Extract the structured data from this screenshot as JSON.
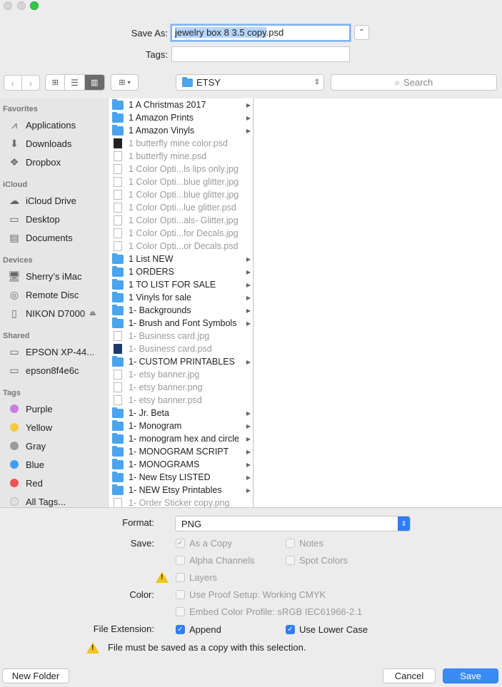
{
  "save_as": {
    "label": "Save As:",
    "value": "jewelry box 8 3.5 copy.psd",
    "selected": "jewelry box 8 3.5 copy",
    "rest": ".psd"
  },
  "tags": {
    "label": "Tags:",
    "value": ""
  },
  "location": {
    "folder": "ETSY"
  },
  "search": {
    "placeholder": "Search"
  },
  "sidebar": {
    "favorites_header": "Favorites",
    "favorites": [
      "Applications",
      "Downloads",
      "Dropbox"
    ],
    "icloud_header": "iCloud",
    "icloud": [
      "iCloud Drive",
      "Desktop",
      "Documents"
    ],
    "devices_header": "Devices",
    "devices": [
      "Sherry’s iMac",
      "Remote Disc",
      "NIKON D7000"
    ],
    "shared_header": "Shared",
    "shared": [
      "EPSON XP-44...",
      "epson8f4e6c"
    ],
    "tags_header": "Tags",
    "tags": [
      {
        "name": "Purple",
        "color": "#c77ede"
      },
      {
        "name": "Yellow",
        "color": "#f6c83e"
      },
      {
        "name": "Gray",
        "color": "#9b9b9b"
      },
      {
        "name": "Blue",
        "color": "#3d9df5"
      },
      {
        "name": "Red",
        "color": "#f2544f"
      },
      {
        "name": "All Tags...",
        "color": "#e0e0e0"
      }
    ]
  },
  "files": [
    {
      "name": "1 A  Christmas 2017",
      "kind": "folder"
    },
    {
      "name": "1 Amazon Prints",
      "kind": "folder"
    },
    {
      "name": "1 Amazon Vinyls",
      "kind": "folder"
    },
    {
      "name": "1 butterfly mine color.psd",
      "kind": "dark"
    },
    {
      "name": "1 butterfly mine.psd",
      "kind": "file"
    },
    {
      "name": "1 Color Opti...ls lips only.jpg",
      "kind": "file"
    },
    {
      "name": "1 Color Opti...blue glitter.jpg",
      "kind": "file"
    },
    {
      "name": "1 Color Opti...blue glitter.jpg",
      "kind": "file"
    },
    {
      "name": "1 Color Opti...lue glitter.psd",
      "kind": "file"
    },
    {
      "name": "1 Color Opti...als- Glitter.jpg",
      "kind": "file"
    },
    {
      "name": "1 Color Opti...for Decals.jpg",
      "kind": "file"
    },
    {
      "name": "1 Color Opti...or Decals.psd",
      "kind": "file"
    },
    {
      "name": "1 List NEW",
      "kind": "folder"
    },
    {
      "name": "1 ORDERS",
      "kind": "folder"
    },
    {
      "name": "1 TO LIST FOR SALE",
      "kind": "folder"
    },
    {
      "name": "1 Vinyls for sale",
      "kind": "folder"
    },
    {
      "name": "1- Backgrounds",
      "kind": "folder"
    },
    {
      "name": "1- Brush and Font Symbols",
      "kind": "folder"
    },
    {
      "name": "1- Business card.jpg",
      "kind": "file"
    },
    {
      "name": "1- Business card.psd",
      "kind": "psd"
    },
    {
      "name": "1- CUSTOM PRINTABLES",
      "kind": "folder"
    },
    {
      "name": "1- etsy banner.jpg",
      "kind": "file"
    },
    {
      "name": "1- etsy banner.png",
      "kind": "file"
    },
    {
      "name": "1- etsy banner.psd",
      "kind": "file"
    },
    {
      "name": "1- Jr. Beta",
      "kind": "folder"
    },
    {
      "name": "1- Monogram",
      "kind": "folder"
    },
    {
      "name": "1- monogram hex and circle",
      "kind": "folder"
    },
    {
      "name": "1- MONOGRAM SCRIPT",
      "kind": "folder"
    },
    {
      "name": "1- MONOGRAMS",
      "kind": "folder"
    },
    {
      "name": "1- New Etsy LISTED",
      "kind": "folder"
    },
    {
      "name": "1- NEW Etsy Printables",
      "kind": "folder"
    },
    {
      "name": "1- Order Sticker copy.png",
      "kind": "file"
    }
  ],
  "options": {
    "format_label": "Format:",
    "format_value": "PNG",
    "save_label": "Save:",
    "as_a_copy": "As a Copy",
    "notes": "Notes",
    "alpha_channels": "Alpha Channels",
    "spot_colors": "Spot Colors",
    "layers": "Layers",
    "color_label": "Color:",
    "use_proof_setup": "Use Proof Setup:  Working CMYK",
    "embed_color_profile": "Embed Color Profile:  sRGB IEC61966-2.1",
    "file_extension_label": "File Extension:",
    "append": "Append",
    "use_lower_case": "Use Lower Case",
    "warning": "File must be saved as a copy with this selection."
  },
  "buttons": {
    "new_folder": "New Folder",
    "cancel": "Cancel",
    "save": "Save"
  },
  "colors": {
    "accent": "#2f7df6",
    "folder": "#4aa4ee"
  }
}
